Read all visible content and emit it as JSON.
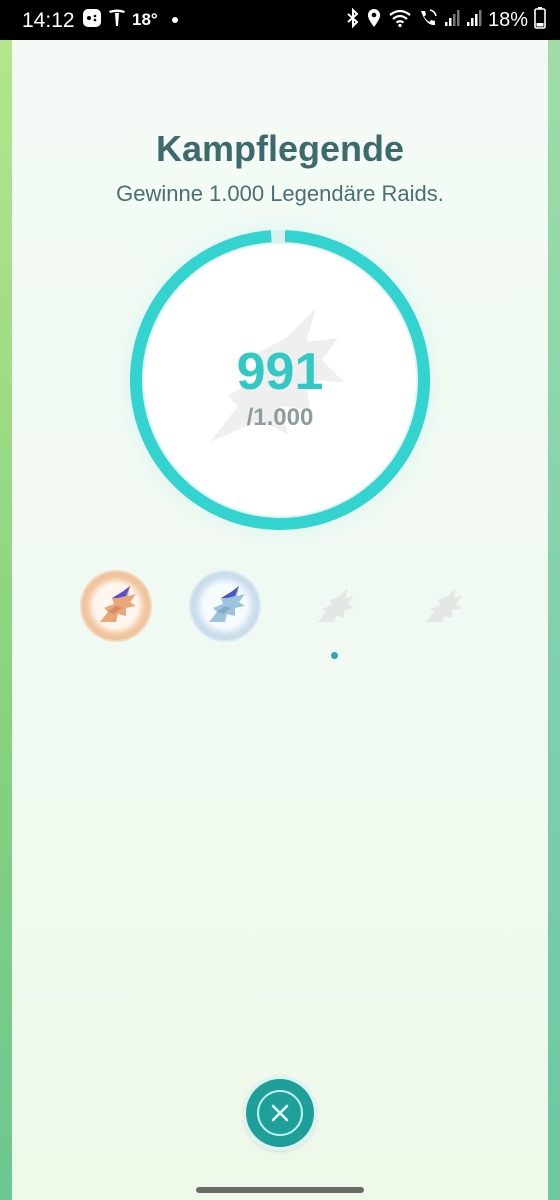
{
  "status_bar": {
    "time": "14:12",
    "temperature": "18°",
    "battery_percent": "18%",
    "icons_left": [
      "game-controller-icon",
      "tesla-icon"
    ],
    "icons_right": [
      "bluetooth-icon",
      "location-pin-icon",
      "wifi-icon",
      "wifi-call-icon",
      "signal-icon",
      "signal-icon",
      "battery-icon"
    ]
  },
  "medal": {
    "title": "Kampflegende",
    "description": "Gewinne 1.000 Legendäre Raids.",
    "progress_value": "991",
    "progress_total": "/1.000",
    "progress_fraction": 0.991,
    "ring_color": "#33d3cf",
    "tiers": [
      {
        "name": "bronze",
        "unlocked": true
      },
      {
        "name": "silver",
        "unlocked": true
      },
      {
        "name": "gold",
        "unlocked": false
      },
      {
        "name": "platinum",
        "unlocked": false
      }
    ],
    "current_page_indicator": "gold"
  },
  "close_button": {
    "icon": "close-icon"
  }
}
